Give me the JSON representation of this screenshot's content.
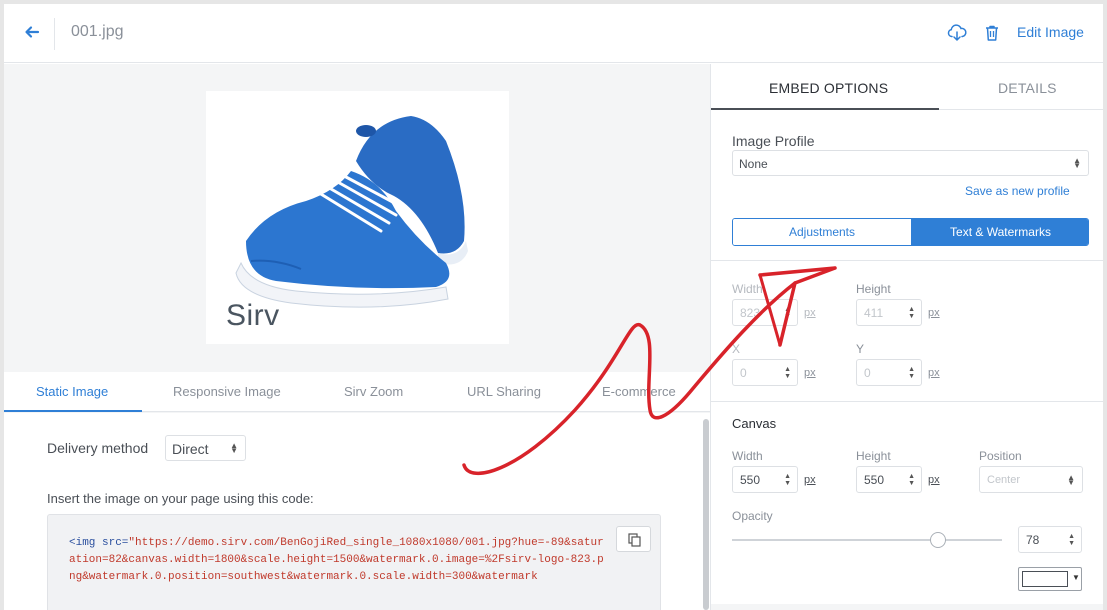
{
  "topbar": {
    "filename": "001.jpg",
    "edit_label": "Edit Image",
    "icons": [
      "back-arrow-icon",
      "download-icon",
      "trash-icon"
    ]
  },
  "preview": {
    "logo_text": "Sirv"
  },
  "left_tabs": [
    {
      "label": "Static Image",
      "active": true
    },
    {
      "label": "Responsive Image",
      "active": false
    },
    {
      "label": "Sirv Zoom",
      "active": false
    },
    {
      "label": "URL Sharing",
      "active": false
    },
    {
      "label": "E-commerce",
      "active": false
    }
  ],
  "delivery": {
    "label": "Delivery method",
    "value": "Direct"
  },
  "insert_label": "Insert the image on your page using this code:",
  "code": {
    "tag_open": "<img src=",
    "url": "\"https://demo.sirv.com/BenGojiRed_single_1080x1080/001.jpg?hue=-89&saturation=82&canvas.width=1800&scale.height=1500&watermark.0.image=%2Fsirv-logo-823.png&watermark.0.position=southwest&watermark.0.scale.width=300&watermark"
  },
  "right_tabs": [
    {
      "label": "EMBED OPTIONS",
      "active": true
    },
    {
      "label": "DETAILS",
      "active": false
    }
  ],
  "profile": {
    "label": "Image Profile",
    "value": "None",
    "save_link": "Save as new profile"
  },
  "segments": {
    "adjustments": "Adjustments",
    "text_watermarks": "Text & Watermarks"
  },
  "watermark": {
    "width_label": "Width",
    "width_value": "823",
    "height_label": "Height",
    "height_value": "411",
    "x_label": "X",
    "x_value": "0",
    "y_label": "Y",
    "y_value": "0",
    "unit": "px"
  },
  "canvas": {
    "title": "Canvas",
    "width_label": "Width",
    "width_value": "550",
    "height_label": "Height",
    "height_value": "550",
    "position_label": "Position",
    "position_value": "Center",
    "opacity_label": "Opacity",
    "opacity_value": "78",
    "unit": "px",
    "color": "#ffffff"
  },
  "colors": {
    "accent": "#2f7fd6",
    "annotation_arrow": "#d8232a"
  }
}
